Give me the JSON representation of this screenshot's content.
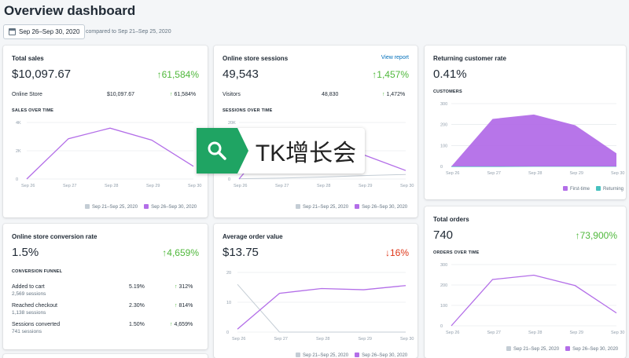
{
  "header": {
    "title": "Overview dashboard",
    "date_range": "Sep 26–Sep 30, 2020",
    "compare": "compared to Sep 21–Sep 25, 2020"
  },
  "colors": {
    "primary": "#b36ee8",
    "secondary": "#c4cdd5",
    "teal": "#47c1bf",
    "up": "#50b83c",
    "down": "#de3618"
  },
  "legend": {
    "prev": "Sep 21–Sep 25, 2020",
    "curr": "Sep 26–Sep 30, 2020"
  },
  "total_sales": {
    "title": "Total sales",
    "value": "$10,097.67",
    "delta": "↑61,584%",
    "row_label": "Online Store",
    "row_value": "$10,097.67",
    "row_delta": "61,584%",
    "section": "SALES OVER TIME"
  },
  "sessions": {
    "title": "Online store sessions",
    "link": "View report",
    "value": "49,543",
    "delta": "↑1,457%",
    "row_label": "Visitors",
    "row_value": "48,830",
    "row_delta": "1,472%",
    "section": "SESSIONS OVER TIME"
  },
  "returning": {
    "title": "Returning customer rate",
    "value": "0.41%",
    "section": "CUSTOMERS",
    "legend_first": "First-time",
    "legend_returning": "Returning"
  },
  "conversion": {
    "title": "Online store conversion rate",
    "value": "1.5%",
    "delta": "↑4,659%",
    "section": "CONVERSION FUNNEL",
    "rows": [
      {
        "label": "Added to cart",
        "sub": "2,569 sessions",
        "pct": "5.19%",
        "delta": "312%"
      },
      {
        "label": "Reached checkout",
        "sub": "1,138 sessions",
        "pct": "2.30%",
        "delta": "814%"
      },
      {
        "label": "Sessions converted",
        "sub": "741 sessions",
        "pct": "1.50%",
        "delta": "4,659%"
      }
    ]
  },
  "aov": {
    "title": "Average order value",
    "value": "$13.75",
    "delta": "↓16%"
  },
  "orders": {
    "title": "Total orders",
    "value": "740",
    "delta": "↑73,900%",
    "section": "ORDERS OVER TIME"
  },
  "overlay": {
    "text": "TK增长会",
    "icon": "search-icon"
  },
  "chart_data": [
    {
      "type": "line",
      "name": "sales",
      "categories": [
        "Sep 26",
        "Sep 27",
        "Sep 28",
        "Sep 29",
        "Sep 30"
      ],
      "yticks": [
        "4K",
        "2K",
        "0"
      ],
      "ylim": [
        0,
        4000
      ],
      "series": [
        {
          "name": "Sep 26–Sep 30, 2020",
          "values": [
            0,
            2850,
            3600,
            2750,
            900
          ]
        }
      ]
    },
    {
      "type": "line",
      "name": "sessions",
      "categories": [
        "Sep 26",
        "Sep 27",
        "Sep 28",
        "Sep 29",
        "Sep 30"
      ],
      "yticks": [
        "20K",
        "10K",
        "0"
      ],
      "ylim": [
        0,
        20000
      ],
      "series": [
        {
          "name": "Sep 26–Sep 30, 2020",
          "values": [
            0,
            17500,
            14000,
            8500,
            3000
          ]
        },
        {
          "name": "Sep 21–Sep 25, 2020",
          "values": [
            100,
            300,
            700,
            1200,
            1600
          ]
        }
      ]
    },
    {
      "type": "area",
      "name": "customers",
      "categories": [
        "Sep 26",
        "Sep 27",
        "Sep 28",
        "Sep 29",
        "Sep 30"
      ],
      "yticks": [
        "300",
        "200",
        "100",
        "0"
      ],
      "ylim": [
        0,
        300
      ],
      "series": [
        {
          "name": "First-time",
          "values": [
            0,
            227,
            248,
            197,
            63
          ]
        },
        {
          "name": "Returning",
          "values": [
            0,
            0,
            1,
            1,
            1
          ]
        }
      ]
    },
    {
      "type": "line",
      "name": "aov",
      "categories": [
        "Sep 26",
        "Sep 27",
        "Sep 28",
        "Sep 29",
        "Sep 30"
      ],
      "yticks": [
        "20",
        "10",
        "0"
      ],
      "ylim": [
        0,
        20
      ],
      "series": [
        {
          "name": "Sep 26–Sep 30, 2020",
          "values": [
            1,
            13,
            14.6,
            14.2,
            15.6
          ]
        },
        {
          "name": "Sep 21–Sep 25, 2020",
          "values": [
            16,
            0,
            0,
            0,
            0
          ]
        }
      ]
    },
    {
      "type": "line",
      "name": "orders",
      "categories": [
        "Sep 26",
        "Sep 27",
        "Sep 28",
        "Sep 29",
        "Sep 30"
      ],
      "yticks": [
        "300",
        "200",
        "100",
        "0"
      ],
      "ylim": [
        0,
        300
      ],
      "series": [
        {
          "name": "Sep 26–Sep 30, 2020",
          "values": [
            0,
            227,
            248,
            197,
            63
          ]
        }
      ]
    }
  ]
}
